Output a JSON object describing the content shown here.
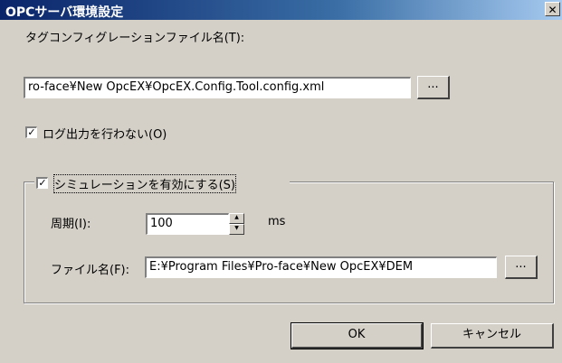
{
  "window": {
    "title": "OPCサーバ環境設定",
    "close_icon": "close-icon"
  },
  "tag_config": {
    "label": "タグコンフィグレーションファイル名(T):",
    "value": "ro-face¥New OpcEX¥OpcEX.Config.Tool.config.xml",
    "browse_label": "..."
  },
  "log": {
    "label": "ログ出力を行わない(O)",
    "checked": true
  },
  "simulation": {
    "label": "シミュレーションを有効にする(S)",
    "checked": true,
    "period_label": "周期(I):",
    "period_value": "100",
    "period_unit": "ms",
    "file_label": "ファイル名(F):",
    "file_value": "E:¥Program Files¥Pro-face¥New OpcEX¥DEM",
    "browse_label": "..."
  },
  "buttons": {
    "ok_label": "OK",
    "cancel_label": "キャンセル"
  }
}
